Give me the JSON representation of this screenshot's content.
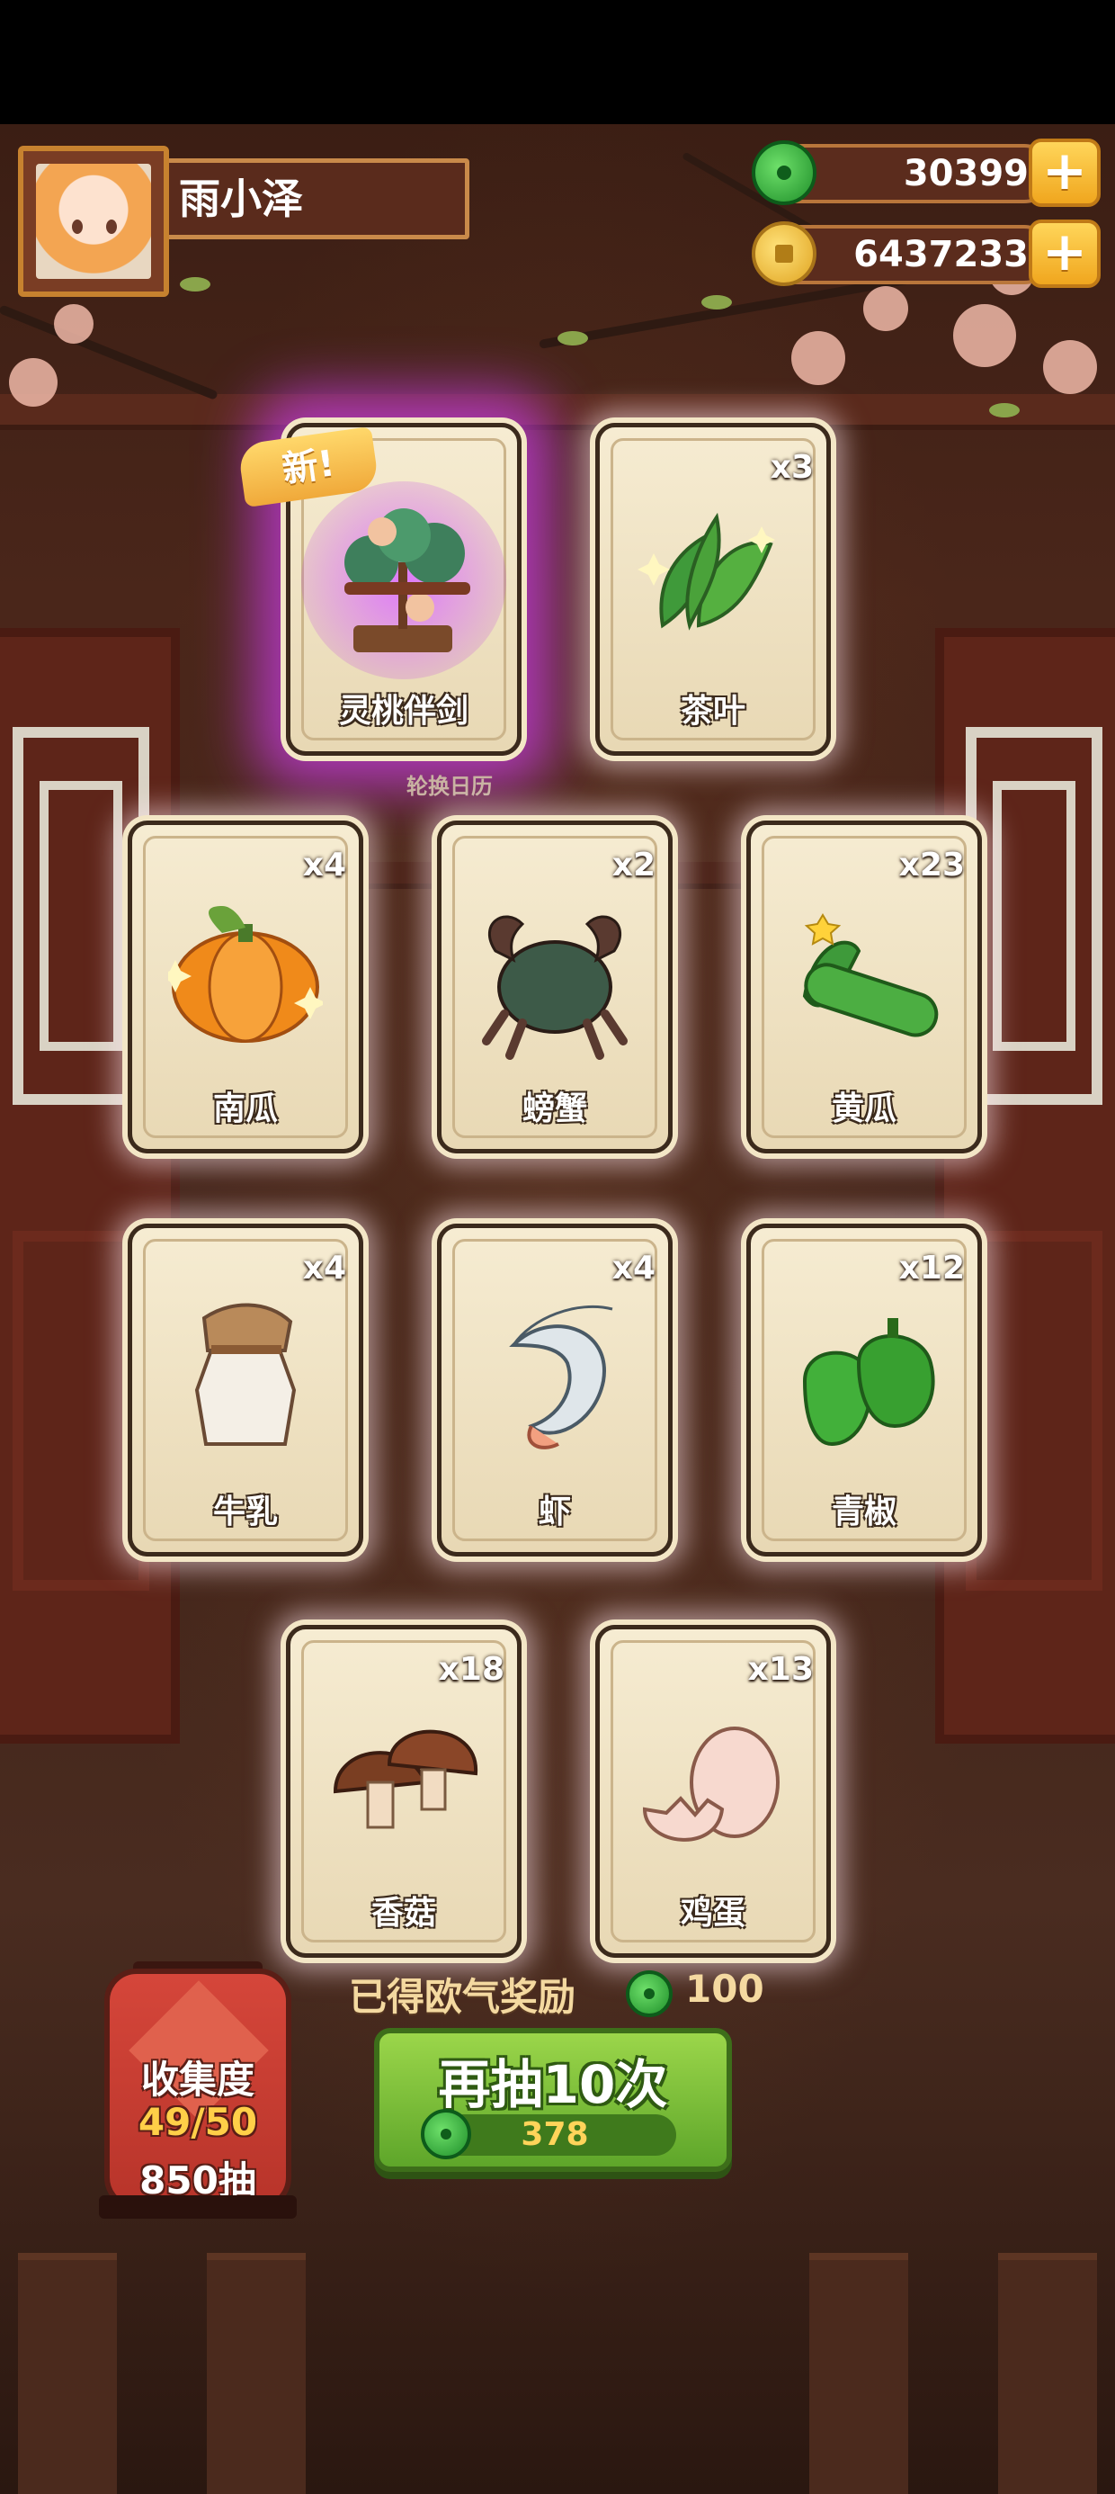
{
  "player": {
    "name": "雨小泽"
  },
  "currencies": [
    {
      "name": "jade",
      "icon": "jade-icon",
      "value": "30399"
    },
    {
      "name": "coin",
      "icon": "coin-icon",
      "value": "6437233"
    }
  ],
  "add_label": "+",
  "new_badge": "新!",
  "background_caption": "轮换日历",
  "cards": [
    {
      "label": "灵桃伴剑",
      "count": "",
      "icon": "peach-bonsai-sword-icon",
      "rare": true
    },
    {
      "label": "茶叶",
      "count": "x3",
      "icon": "tea-leaves-icon"
    },
    {
      "label": "南瓜",
      "count": "x4",
      "icon": "pumpkin-icon"
    },
    {
      "label": "螃蟹",
      "count": "x2",
      "icon": "crab-icon"
    },
    {
      "label": "黄瓜",
      "count": "x23",
      "icon": "cucumber-icon"
    },
    {
      "label": "牛乳",
      "count": "x4",
      "icon": "milk-jar-icon"
    },
    {
      "label": "虾",
      "count": "x4",
      "icon": "shrimp-icon"
    },
    {
      "label": "青椒",
      "count": "x12",
      "icon": "green-pepper-icon"
    },
    {
      "label": "香菇",
      "count": "x18",
      "icon": "shiitake-icon"
    },
    {
      "label": "鸡蛋",
      "count": "x13",
      "icon": "egg-icon"
    }
  ],
  "reward": {
    "label": "已得欧气奖励",
    "value": "100",
    "icon": "jade-icon"
  },
  "draw_button": {
    "label": "再抽10次",
    "cost": "378",
    "icon": "jade-icon"
  },
  "collection": {
    "title": "收集度",
    "progress": "49/50",
    "draws": "850抽"
  },
  "colors": {
    "jade": "#2fa83a",
    "gold": "#f0a61e",
    "button_green": "#7cc23a",
    "rare_glow": "#c83ce6"
  }
}
